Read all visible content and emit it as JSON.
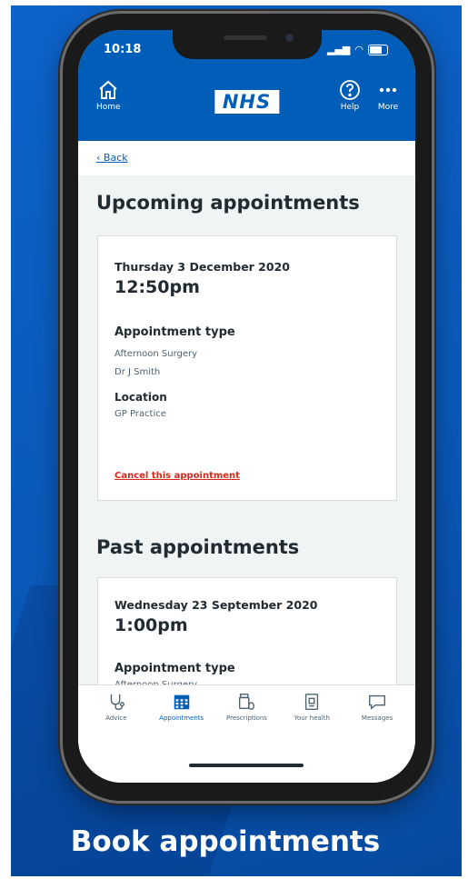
{
  "status_bar": {
    "time": "10:18"
  },
  "header": {
    "home_label": "Home",
    "logo_text": "NHS",
    "help_label": "Help",
    "more_label": "More"
  },
  "back_label": "Back",
  "upcoming": {
    "title": "Upcoming appointments",
    "date": "Thursday 3 December 2020",
    "time": "12:50pm",
    "type_label": "Appointment type",
    "type_value": "Afternoon Surgery",
    "clinician": "Dr J Smith",
    "location_label": "Location",
    "location_value": "GP Practice",
    "cancel_label": "Cancel this appointment"
  },
  "past": {
    "title": "Past appointments",
    "date": "Wednesday 23 September 2020",
    "time": "1:00pm",
    "type_label": "Appointment type",
    "type_value": "Afternoon Surgery"
  },
  "tabbar": {
    "items": [
      {
        "label": "Advice",
        "icon": "advice-icon"
      },
      {
        "label": "Appointments",
        "icon": "calendar-icon"
      },
      {
        "label": "Prescriptions",
        "icon": "prescriptions-icon"
      },
      {
        "label": "Your health",
        "icon": "health-record-icon"
      },
      {
        "label": "Messages",
        "icon": "message-icon"
      }
    ],
    "active_index": 1
  },
  "caption": "Book appointments",
  "colors": {
    "nhs_blue": "#005eb8",
    "promo_blue": "#0a58b8",
    "cancel_red": "#d5281b"
  }
}
